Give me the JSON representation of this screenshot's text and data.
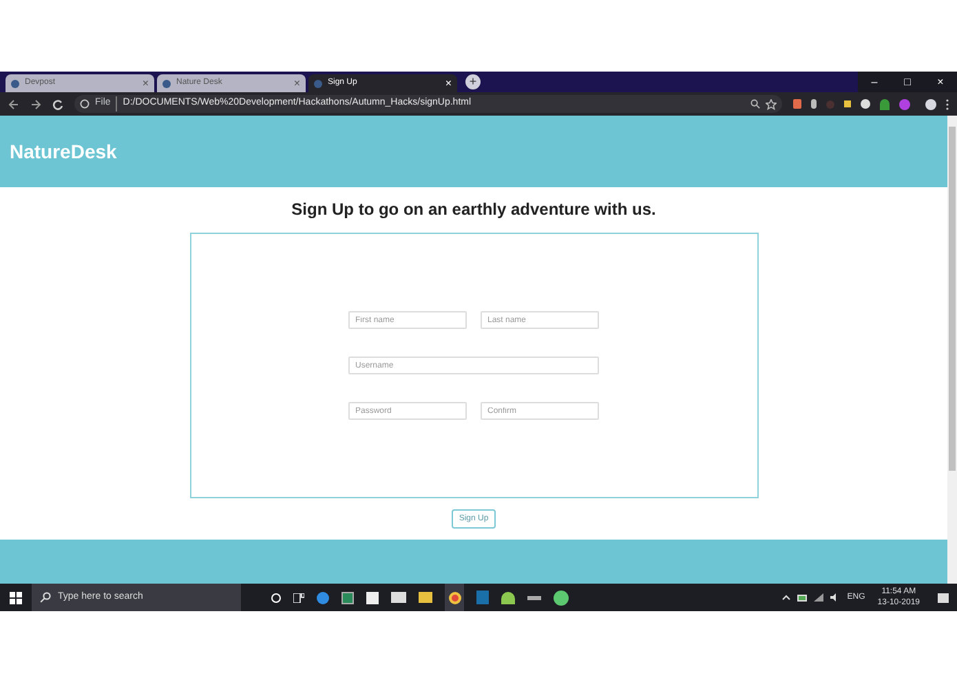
{
  "tabs": [
    {
      "title": "Devpost",
      "selected": false,
      "close": "×"
    },
    {
      "title": "Nature Desk",
      "selected": false,
      "close": "×"
    },
    {
      "title": "Sign Up",
      "selected": true,
      "close": "×"
    }
  ],
  "new_tab": "+",
  "window_controls": [
    "–",
    "□",
    "×"
  ],
  "address_bar": {
    "scheme": "File",
    "url": "D:/DOCUMENTS/Web%20Development/Hackathons/Autumn_Hacks/signUp.html"
  },
  "page": {
    "brand": "NatureDesk",
    "heading": "Sign Up to go on an earthly adventure with us.",
    "fields": [
      [
        {
          "placeholder": "First name"
        },
        {
          "placeholder": "Last name"
        }
      ],
      [
        {
          "placeholder": "Username"
        }
      ],
      [
        {
          "placeholder": "Password"
        },
        {
          "placeholder": "Confirm"
        }
      ]
    ],
    "submit": "Sign Up"
  },
  "taskbar": {
    "search": {
      "placeholder": "Type here to search"
    },
    "language": "ENG",
    "time": "11:54 AM",
    "date": "13-10-2019"
  }
}
